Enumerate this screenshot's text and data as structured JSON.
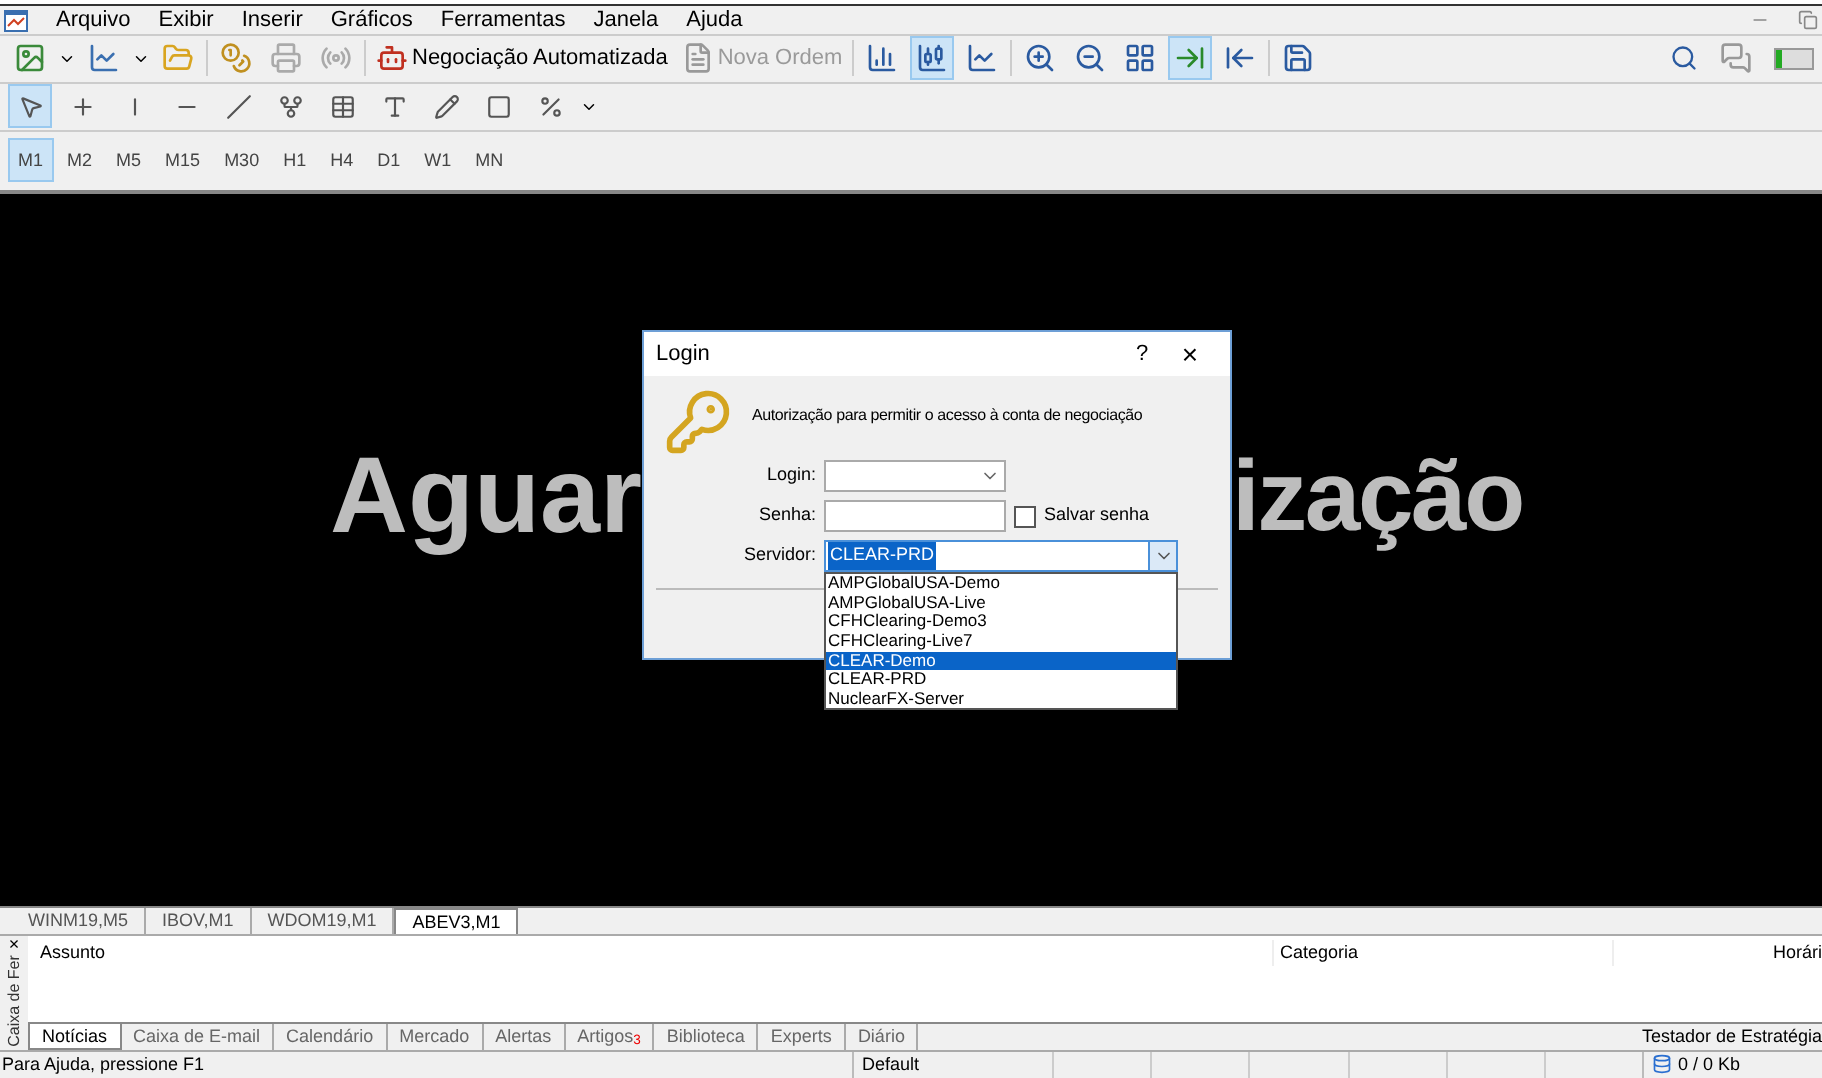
{
  "menu": [
    "Arquivo",
    "Exibir",
    "Inserir",
    "Gráficos",
    "Ferramentas",
    "Janela",
    "Ajuda"
  ],
  "toolbar": {
    "auto_trading": "Negociação Automatizada",
    "new_order": {
      "label": "Nova Ordem",
      "disabled": true
    },
    "chart_modes": [
      {
        "selected": false
      },
      {
        "selected": true
      },
      {
        "selected": false
      }
    ],
    "auto_scroll": {
      "selected": true
    },
    "chart_shift": {
      "selected": false
    }
  },
  "drawing_tools": [
    {
      "selected": true
    },
    {
      "selected": false
    },
    {
      "selected": false
    },
    {
      "selected": false
    },
    {
      "selected": false
    },
    {
      "selected": false
    },
    {
      "selected": false
    },
    {
      "selected": false
    },
    {
      "selected": false
    },
    {
      "selected": false
    },
    {
      "selected": false
    }
  ],
  "timeframes": [
    {
      "label": "M1",
      "selected": true
    },
    {
      "label": "M2",
      "selected": false
    },
    {
      "label": "M5",
      "selected": false
    },
    {
      "label": "M15",
      "selected": false
    },
    {
      "label": "M30",
      "selected": false
    },
    {
      "label": "H1",
      "selected": false
    },
    {
      "label": "H4",
      "selected": false
    },
    {
      "label": "D1",
      "selected": false
    },
    {
      "label": "W1",
      "selected": false
    },
    {
      "label": "MN",
      "selected": false
    }
  ],
  "chart": {
    "banner_left": "Aguar",
    "banner_right": "ização"
  },
  "login_dialog": {
    "title": "Login",
    "help": "?",
    "close": "×",
    "message": "Autorização para permitir o acesso à conta de negociação",
    "login_label": "Login:",
    "password_label": "Senha:",
    "save_password": {
      "label": "Salvar senha",
      "checked": false
    },
    "server_label": "Servidor:",
    "server_value": "CLEAR-PRD",
    "server_options": [
      {
        "label": "AMPGlobalUSA-Demo",
        "selected": false
      },
      {
        "label": "AMPGlobalUSA-Live",
        "selected": false
      },
      {
        "label": "CFHClearing-Demo3",
        "selected": false
      },
      {
        "label": "CFHClearing-Live7",
        "selected": false
      },
      {
        "label": "CLEAR-Demo",
        "selected": true
      },
      {
        "label": "CLEAR-PRD",
        "selected": false
      },
      {
        "label": "NuclearFX-Server",
        "selected": false
      }
    ]
  },
  "chart_tabs": [
    {
      "label": "WINM19,M5",
      "selected": false
    },
    {
      "label": "IBOV,M1",
      "selected": false
    },
    {
      "label": "WDOM19,M1",
      "selected": false
    },
    {
      "label": "ABEV3,M1",
      "selected": true
    }
  ],
  "toolbox": {
    "side_title": "Caixa de Fer",
    "close": "×",
    "columns": [
      "Assunto",
      "Categoria",
      "Horári"
    ],
    "tabs": [
      {
        "label": "Notícias",
        "selected": true
      },
      {
        "label": "Caixa de E-mail",
        "selected": false
      },
      {
        "label": "Calendário",
        "selected": false
      },
      {
        "label": "Mercado",
        "selected": false
      },
      {
        "label": "Alertas",
        "selected": false
      },
      {
        "label": "Artigos$_{3}$",
        "selected": false
      },
      {
        "label": "Biblioteca",
        "selected": false
      },
      {
        "label": "Experts",
        "selected": false
      },
      {
        "label": "Diário",
        "selected": false
      }
    ],
    "strategy_tester": "Testador de Estratégia"
  },
  "status_bar": {
    "help": "Para Ajuda, pressione F1",
    "profile": "Default",
    "traffic": "0 / 0 Kb"
  }
}
